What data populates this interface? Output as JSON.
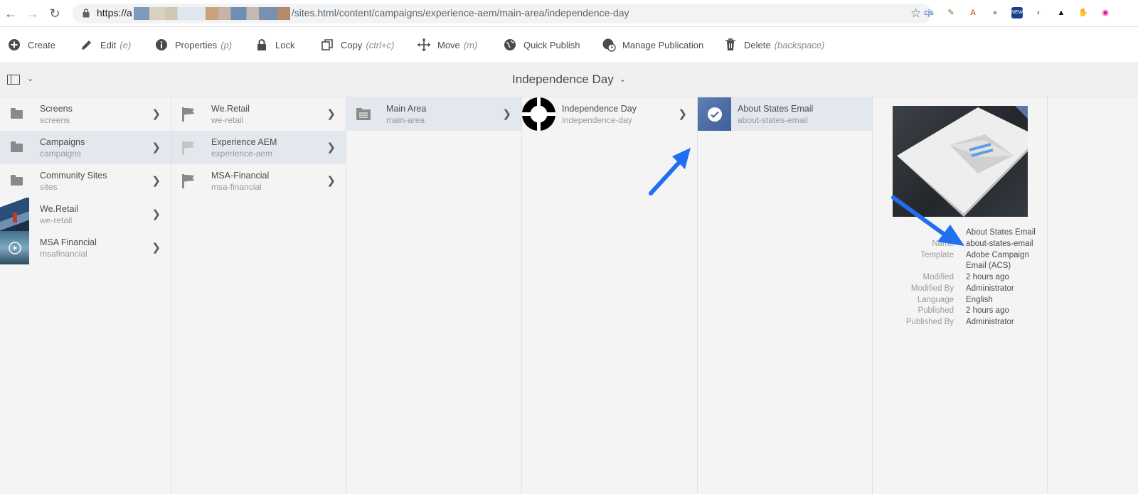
{
  "browser": {
    "url_prefix": "https://a",
    "url_path": "/sites.html/content/campaigns/experience-aem/main-area/independence-day",
    "extensions": [
      {
        "name": "cjs-extension",
        "label": "cjs",
        "color": "#3a55c7"
      },
      {
        "name": "pen-extension",
        "label": "✎",
        "color": "#8a5a1e"
      },
      {
        "name": "pdf-extension",
        "label": "A",
        "color": "#d81e06"
      },
      {
        "name": "circle-extension",
        "label": "●",
        "color": "#9e9e9e"
      },
      {
        "name": "news-extension",
        "label": "NEW",
        "color": "#1b3f8f"
      },
      {
        "name": "globe-extension",
        "label": "◐",
        "color": "#4a90d9"
      },
      {
        "name": "spy-extension",
        "label": "▲",
        "color": "#111111"
      },
      {
        "name": "stop-extension",
        "label": "✋",
        "color": "#e32227"
      },
      {
        "name": "eye-extension",
        "label": "◉",
        "color": "#e0118f"
      }
    ]
  },
  "toolbar": {
    "items": [
      {
        "label": "Create",
        "hint": ""
      },
      {
        "label": "Edit",
        "hint": "(e)"
      },
      {
        "label": "Properties",
        "hint": "(p)"
      },
      {
        "label": "Lock",
        "hint": ""
      },
      {
        "label": "Copy",
        "hint": "(ctrl+c)"
      },
      {
        "label": "Move",
        "hint": "(m)"
      },
      {
        "label": "Quick Publish",
        "hint": ""
      },
      {
        "label": "Manage Publication",
        "hint": ""
      },
      {
        "label": "Delete",
        "hint": "(backspace)"
      }
    ]
  },
  "header": {
    "title": "Independence Day"
  },
  "columns": [
    {
      "rows": [
        {
          "title": "Screens",
          "sub": "screens",
          "thumb": "folder-icon",
          "selected": false
        },
        {
          "title": "Campaigns",
          "sub": "campaigns",
          "thumb": "folder-icon",
          "selected": true
        },
        {
          "title": "Community Sites",
          "sub": "sites",
          "thumb": "folder-icon",
          "selected": false
        },
        {
          "title": "We.Retail",
          "sub": "we-retail",
          "thumb": "we-retail-thumbnail",
          "selected": false
        },
        {
          "title": "MSA Financial",
          "sub": "msafinancial",
          "thumb": "msa-financial-thumbnail",
          "selected": false
        }
      ]
    },
    {
      "rows": [
        {
          "title": "We.Retail",
          "sub": "we-retail",
          "thumb": "flag-icon",
          "selected": false
        },
        {
          "title": "Experience AEM",
          "sub": "experience-aem",
          "thumb": "flag-icon",
          "selected": true
        },
        {
          "title": "MSA-Financial",
          "sub": "msa-financial",
          "thumb": "flag-icon",
          "selected": false
        }
      ]
    },
    {
      "rows": [
        {
          "title": "Main Area",
          "sub": "main-area",
          "thumb": "area-icon",
          "selected": true
        }
      ]
    },
    {
      "rows": [
        {
          "title": "Independence Day",
          "sub": "independence-day",
          "thumb": "target-icon",
          "selected": false
        }
      ]
    },
    {
      "rows": [
        {
          "title": "About States Email",
          "sub": "about-states-email",
          "thumb": "email-thumbnail",
          "selected": true
        }
      ]
    }
  ],
  "details": {
    "title": "About States Email",
    "fields": [
      {
        "key": "Name",
        "value": "about-states-email"
      },
      {
        "key": "Template",
        "value": "Adobe Campaign"
      },
      {
        "key": "",
        "value": "Email (ACS)"
      },
      {
        "key": "Modified",
        "value": "2 hours ago"
      },
      {
        "key": "Modified By",
        "value": "Administrator"
      },
      {
        "key": "Language",
        "value": "English"
      },
      {
        "key": "Published",
        "value": "2 hours ago"
      },
      {
        "key": "Published By",
        "value": "Administrator"
      }
    ]
  },
  "colors": {
    "accent_arrow": "#1f6ff0",
    "selected_row": "#e3e7ee",
    "background": "#f4f4f4"
  }
}
